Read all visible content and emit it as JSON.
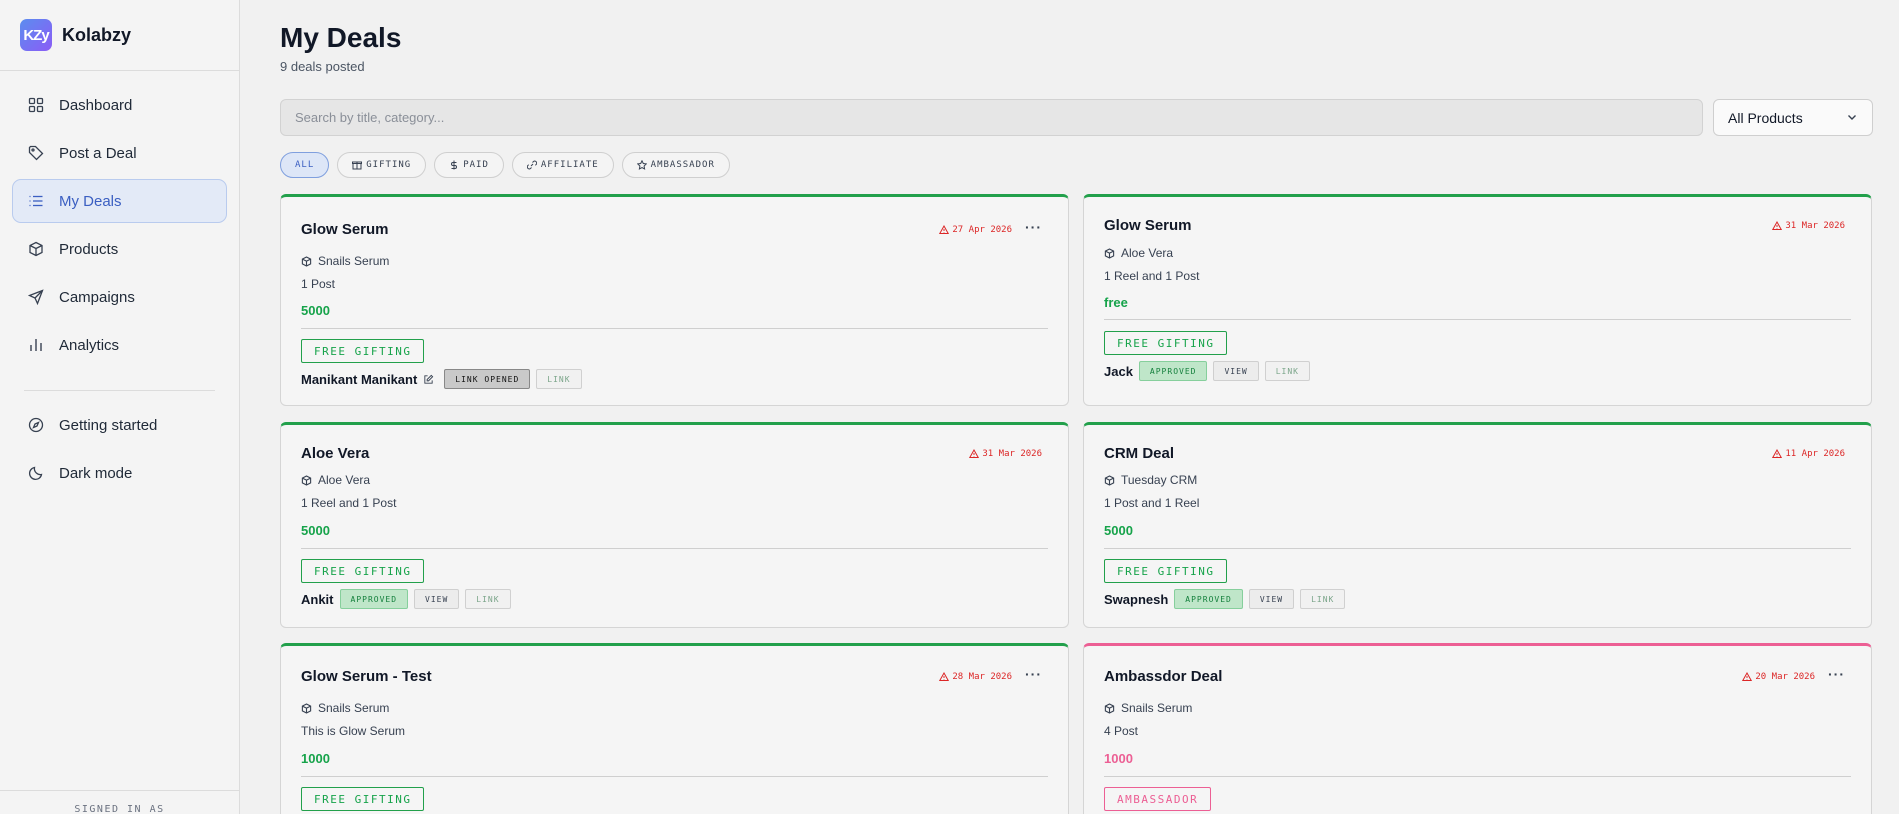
{
  "app": {
    "name": "Kolabzy",
    "logo_text": "KZy"
  },
  "sidebar": {
    "items": [
      {
        "label": "Dashboard",
        "icon": "grid-icon"
      },
      {
        "label": "Post a Deal",
        "icon": "tag-icon"
      },
      {
        "label": "My Deals",
        "icon": "list-icon",
        "active": true
      },
      {
        "label": "Products",
        "icon": "box-icon"
      },
      {
        "label": "Campaigns",
        "icon": "send-icon"
      },
      {
        "label": "Analytics",
        "icon": "bar-chart-icon"
      }
    ],
    "secondary": [
      {
        "label": "Getting started",
        "icon": "compass-icon"
      },
      {
        "label": "Dark mode",
        "icon": "moon-icon"
      }
    ],
    "signed_in_label": "SIGNED IN AS"
  },
  "header": {
    "title": "My Deals",
    "subtitle": "9 deals posted"
  },
  "search": {
    "placeholder": "Search by title, category..."
  },
  "product_filter": {
    "selected": "All Products"
  },
  "filters": [
    {
      "label": "ALL",
      "active": true
    },
    {
      "label": "GIFTING",
      "icon": "gift-icon"
    },
    {
      "label": "PAID",
      "icon": "dollar-icon"
    },
    {
      "label": "AFFILIATE",
      "icon": "link-icon"
    },
    {
      "label": "AMBASSADOR",
      "icon": "star-icon"
    }
  ],
  "deals": [
    {
      "title": "Glow Serum",
      "date": "27 Apr 2026",
      "product": "Snails Serum",
      "deliverables": "1 Post",
      "price": "5000",
      "type": "FREE GIFTING",
      "creator": "Manikant Manikant",
      "buttons": [
        "LINK OPENED",
        "LINK"
      ]
    },
    {
      "title": "Glow Serum",
      "date": "31 Mar 2026",
      "product": "Aloe Vera",
      "deliverables": "1 Reel and 1 Post",
      "price": "free",
      "type": "FREE GIFTING",
      "creator": "Jack",
      "buttons": [
        "APPROVED",
        "VIEW",
        "LINK"
      ]
    },
    {
      "title": "Aloe Vera",
      "date": "31 Mar 2026",
      "product": "Aloe Vera",
      "deliverables": "1 Reel and 1 Post",
      "price": "5000",
      "type": "FREE GIFTING",
      "creator": "Ankit",
      "buttons": [
        "APPROVED",
        "VIEW",
        "LINK"
      ]
    },
    {
      "title": "CRM Deal",
      "date": "11 Apr 2026",
      "product": "Tuesday CRM",
      "deliverables": "1 Post and 1 Reel",
      "price": "5000",
      "type": "FREE GIFTING",
      "creator": "Swapnesh",
      "buttons": [
        "APPROVED",
        "VIEW",
        "LINK"
      ]
    },
    {
      "title": "Glow Serum - Test",
      "date": "28 Mar 2026",
      "product": "Snails Serum",
      "deliverables": "This is Glow Serum",
      "price": "1000",
      "type": "FREE GIFTING"
    },
    {
      "title": "Ambassdor Deal",
      "date": "20 Mar 2026",
      "product": "Snails Serum",
      "deliverables": "4 Post",
      "price": "1000",
      "type": "AMBASSADOR"
    }
  ],
  "colors": {
    "accent": "#3b5fc2",
    "green": "#22a04b",
    "pink": "#ec5f94",
    "date_red": "#dc2626"
  }
}
